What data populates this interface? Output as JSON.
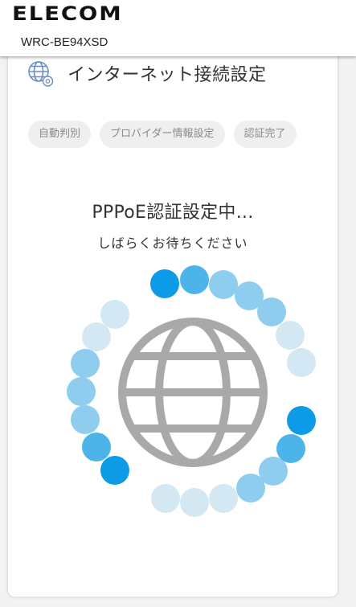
{
  "header": {
    "brand": "ELECOM",
    "model": "WRC-BE94XSD"
  },
  "page": {
    "title": "インターネット接続設定",
    "title_icon": "globe-settings-icon"
  },
  "steps": [
    {
      "label": "自動判別"
    },
    {
      "label": "プロバイダー情報設定"
    },
    {
      "label": "認証完了"
    }
  ],
  "status": {
    "title": "PPPoE認証設定中...",
    "subtitle": "しばらくお待ちください"
  },
  "spinner": {
    "icon": "globe-icon",
    "colors": {
      "strong": "#0d9ae6",
      "mid": "#4db4ea",
      "light": "#8fcdee",
      "pale": "#d3e8f3",
      "globe": "#a9a9a9"
    }
  }
}
